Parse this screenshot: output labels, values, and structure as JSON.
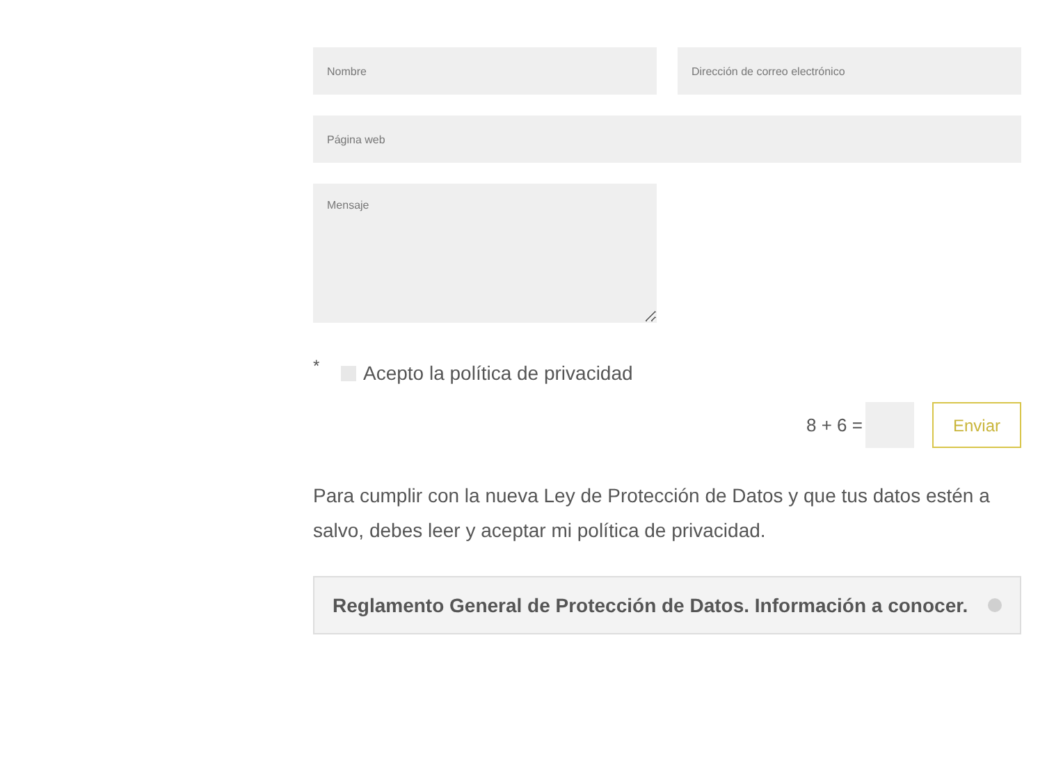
{
  "fields": [
    {
      "placeholder": "Nombre"
    },
    {
      "placeholder": "Dirección de correo electrónico"
    },
    {
      "placeholder": "Página web"
    },
    {
      "placeholder": "Mensaje"
    }
  ],
  "consent": {
    "required_mark": "*",
    "label": "Acepto la política de privacidad",
    "checked": false
  },
  "captcha": {
    "question": "8 + 6 ="
  },
  "submit": {
    "label": "Enviar"
  },
  "notice": "Para cumplir con la nueva Ley de Protección de Datos y que tus datos estén a salvo, debes leer y aceptar mi política de privacidad.",
  "accordion": {
    "title": "Reglamento General de Protección de Datos. Información a conocer.",
    "expanded": false
  }
}
